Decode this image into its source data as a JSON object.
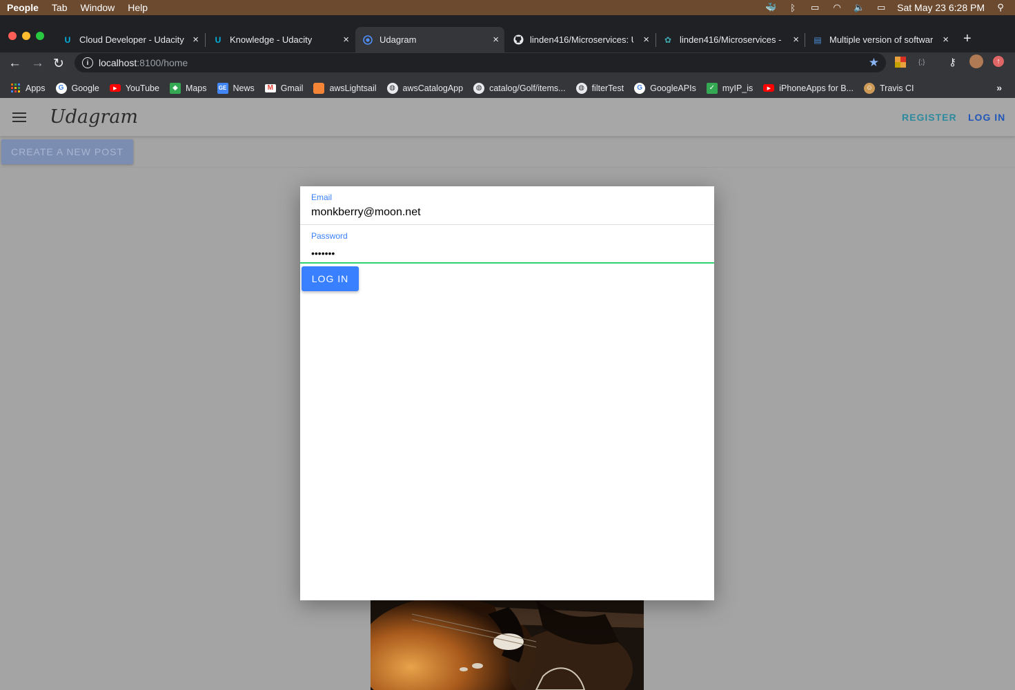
{
  "menubar": {
    "items": [
      "People",
      "Tab",
      "Window",
      "Help"
    ],
    "clock": "Sat May 23  6:28 PM"
  },
  "browser": {
    "tabs": [
      {
        "title": "Cloud Developer - Udacity",
        "icon": "udacity-icon"
      },
      {
        "title": "Knowledge - Udacity",
        "icon": "udacity-icon"
      },
      {
        "title": "Udagram",
        "icon": "ionic-icon",
        "active": true
      },
      {
        "title": "linden416/Microservices: U",
        "icon": "github-icon"
      },
      {
        "title": "linden416/Microservices - ",
        "icon": "travis-icon"
      },
      {
        "title": "Multiple version of softwar",
        "icon": "stackexchange-icon"
      }
    ],
    "url_host": "localhost",
    "url_path": ":8100/home",
    "bookmarks": [
      {
        "label": "Apps",
        "icon": "apps-grid-icon"
      },
      {
        "label": "Google",
        "icon": "google-icon"
      },
      {
        "label": "YouTube",
        "icon": "youtube-icon"
      },
      {
        "label": "Maps",
        "icon": "maps-icon"
      },
      {
        "label": "News",
        "icon": "news-icon"
      },
      {
        "label": "Gmail",
        "icon": "gmail-icon"
      },
      {
        "label": "awsLightsail",
        "icon": "aws-lightsail-icon"
      },
      {
        "label": "awsCatalogApp",
        "icon": "globe-icon"
      },
      {
        "label": "catalog/Golf/items...",
        "icon": "globe-icon"
      },
      {
        "label": "filterTest",
        "icon": "globe-icon"
      },
      {
        "label": "GoogleAPIs",
        "icon": "google-icon"
      },
      {
        "label": "myIP_is",
        "icon": "checkmark-icon"
      },
      {
        "label": "iPhoneApps for B...",
        "icon": "youtube-icon"
      },
      {
        "label": "Travis CI",
        "icon": "travis-icon"
      }
    ]
  },
  "app": {
    "brand": "Udagram",
    "register_label": "REGISTER",
    "login_label": "LOG IN",
    "create_post_label": "CREATE A NEW POST"
  },
  "login_modal": {
    "email_label": "Email",
    "email_value": "monkberry@moon.net",
    "password_label": "Password",
    "password_value": "•••••••",
    "submit_label": "LOG IN"
  },
  "colors": {
    "primary": "#3880ff",
    "success": "#2dd36f",
    "register": "#2d8a9e",
    "login_link": "#2257b8"
  }
}
